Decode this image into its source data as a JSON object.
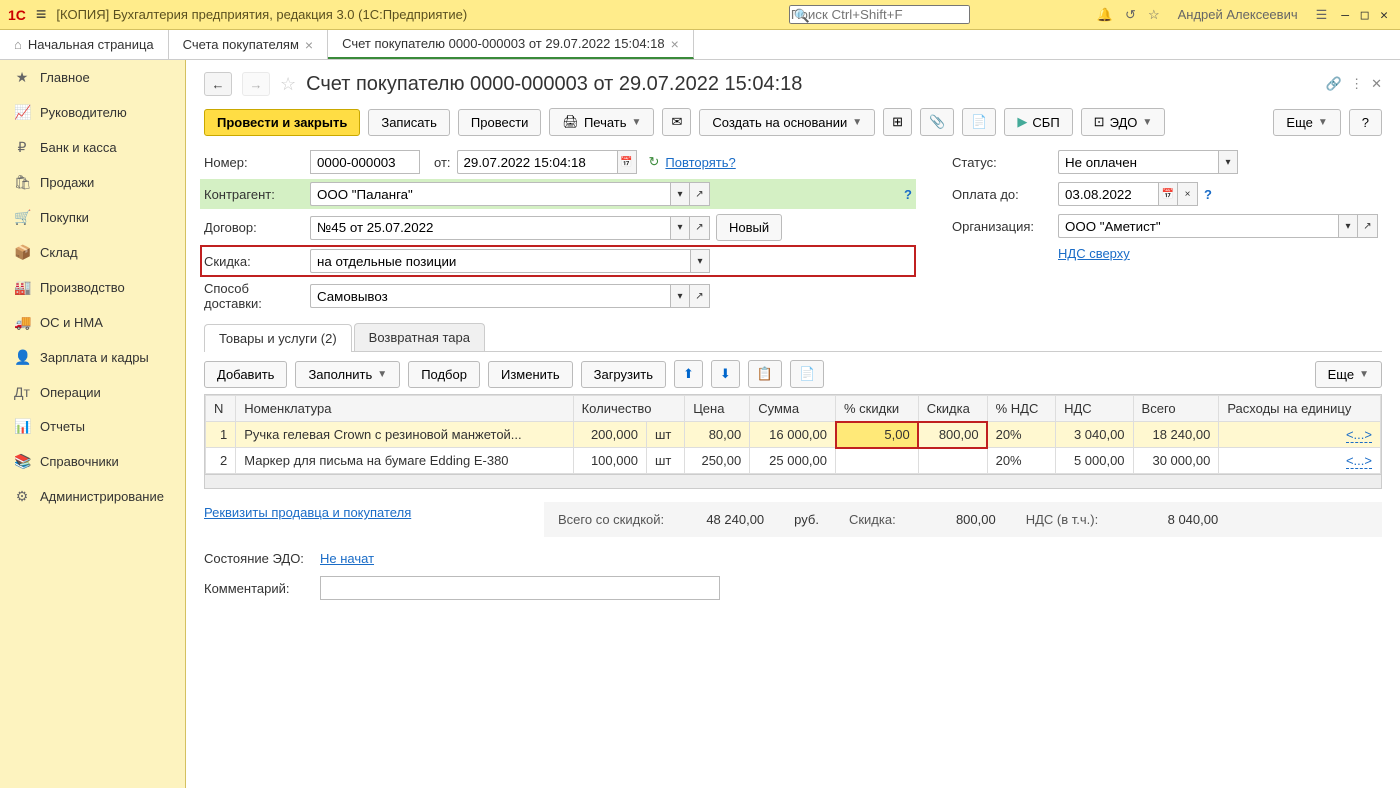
{
  "titlebar": {
    "app_title": "[КОПИЯ] Бухгалтерия предприятия, редакция 3.0  (1С:Предприятие)",
    "search_placeholder": "Поиск Ctrl+Shift+F",
    "user": "Андрей Алексеевич"
  },
  "tabs": {
    "home": "Начальная страница",
    "t1": "Счета покупателям",
    "t2": "Счет покупателю 0000-000003 от 29.07.2022 15:04:18"
  },
  "sidebar": {
    "items": [
      {
        "label": "Главное",
        "icon": "★"
      },
      {
        "label": "Руководителю",
        "icon": "📈"
      },
      {
        "label": "Банк и касса",
        "icon": "₽"
      },
      {
        "label": "Продажи",
        "icon": "🛍"
      },
      {
        "label": "Покупки",
        "icon": "🛒"
      },
      {
        "label": "Склад",
        "icon": "📦"
      },
      {
        "label": "Производство",
        "icon": "🏭"
      },
      {
        "label": "ОС и НМА",
        "icon": "🚚"
      },
      {
        "label": "Зарплата и кадры",
        "icon": "👤"
      },
      {
        "label": "Операции",
        "icon": "Дт"
      },
      {
        "label": "Отчеты",
        "icon": "📊"
      },
      {
        "label": "Справочники",
        "icon": "📚"
      },
      {
        "label": "Администрирование",
        "icon": "⚙"
      }
    ]
  },
  "doc": {
    "title": "Счет покупателю 0000-000003 от 29.07.2022 15:04:18",
    "toolbar": {
      "post_close": "Провести и закрыть",
      "write": "Записать",
      "post": "Провести",
      "print": "Печать",
      "create_based": "Создать на основании",
      "sbp": "СБП",
      "edo": "ЭДО",
      "more": "Еще",
      "help": "?"
    },
    "fields": {
      "number_label": "Номер:",
      "number": "0000-000003",
      "from_label": "от:",
      "date": "29.07.2022 15:04:18",
      "repeat": "Повторять?",
      "contragent_label": "Контрагент:",
      "contragent": "ООО \"Паланга\"",
      "contract_label": "Договор:",
      "contract": "№45 от 25.07.2022",
      "new_btn": "Новый",
      "discount_label": "Скидка:",
      "discount": "на отдельные позиции",
      "delivery_label": "Способ доставки:",
      "delivery": "Самовывоз",
      "status_label": "Статус:",
      "status": "Не оплачен",
      "pay_until_label": "Оплата до:",
      "pay_until": "03.08.2022",
      "org_label": "Организация:",
      "org": "ООО \"Аметист\"",
      "vat_link": "НДС сверху"
    },
    "subtabs": {
      "goods": "Товары и услуги (2)",
      "tara": "Возвратная тара"
    },
    "table_toolbar": {
      "add": "Добавить",
      "fill": "Заполнить",
      "pick": "Подбор",
      "change": "Изменить",
      "load": "Загрузить",
      "more": "Еще"
    },
    "columns": {
      "n": "N",
      "nomen": "Номенклатура",
      "qty": "Количество",
      "unit": "",
      "price": "Цена",
      "sum": "Сумма",
      "disc_pct": "% скидки",
      "disc": "Скидка",
      "vat_pct": "% НДС",
      "vat": "НДС",
      "total": "Всего",
      "exp_unit": "Расходы на единицу"
    },
    "rows": [
      {
        "n": "1",
        "nomen": "Ручка гелевая Crown с резиновой манжетой...",
        "qty": "200,000",
        "unit": "шт",
        "price": "80,00",
        "sum": "16 000,00",
        "disc_pct": "5,00",
        "disc": "800,00",
        "vat_pct": "20%",
        "vat": "3 040,00",
        "total": "18 240,00",
        "exp": "<...>"
      },
      {
        "n": "2",
        "nomen": "Маркер для письма на бумаге Edding E-380",
        "qty": "100,000",
        "unit": "шт",
        "price": "250,00",
        "sum": "25 000,00",
        "disc_pct": "",
        "disc": "",
        "vat_pct": "20%",
        "vat": "5 000,00",
        "total": "30 000,00",
        "exp": "<...>"
      }
    ],
    "totals": {
      "total_label": "Всего со скидкой:",
      "total": "48 240,00",
      "currency": "руб.",
      "disc_label": "Скидка:",
      "disc": "800,00",
      "vat_label": "НДС (в т.ч.):",
      "vat": "8 040,00"
    },
    "footer": {
      "requisites": "Реквизиты продавца и покупателя",
      "edo_state_label": "Состояние ЭДО:",
      "edo_state": "Не начат",
      "comment_label": "Комментарий:"
    }
  }
}
